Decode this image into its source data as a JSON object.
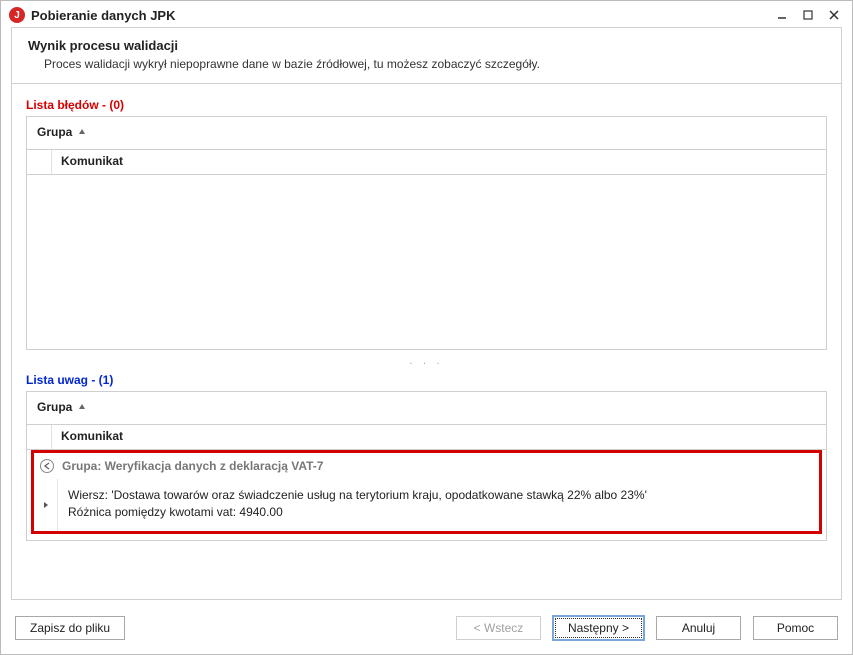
{
  "window": {
    "title": "Pobieranie danych JPK",
    "app_initial": "J"
  },
  "header": {
    "title": "Wynik procesu walidacji",
    "subtitle": "Proces walidacji wykrył niepoprawne dane w bazie źródłowej, tu możesz zobaczyć szczegóły."
  },
  "errors": {
    "section_label": "Lista błędów - (0)",
    "group_label": "Grupa",
    "column_label": "Komunikat"
  },
  "remarks": {
    "section_label": "Lista uwag - (1)",
    "group_label": "Grupa",
    "column_label": "Komunikat",
    "group_row": "Grupa: Weryfikacja danych z deklaracją VAT-7",
    "message_line1": "Wiersz: 'Dostawa towarów oraz świadczenie usług na terytorium kraju, opodatkowane stawką 22% albo 23%'",
    "message_line2": "Różnica pomiędzy kwotami vat: 4940.00"
  },
  "buttons": {
    "save": "Zapisz do pliku",
    "back": "< Wstecz",
    "next": "Następny >",
    "cancel": "Anuluj",
    "help": "Pomoc"
  }
}
